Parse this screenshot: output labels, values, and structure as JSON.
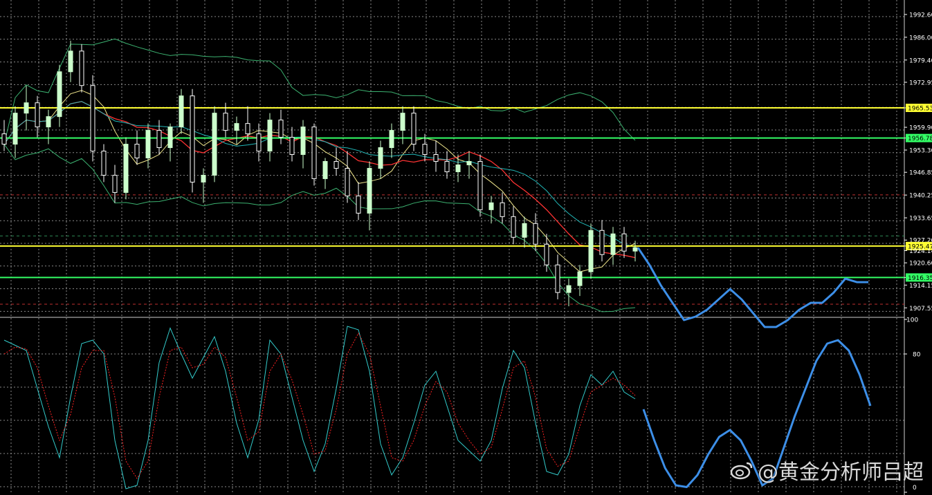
{
  "chart_data": [
    {
      "type": "candlestick",
      "panel": "price",
      "title": "",
      "grid": true,
      "yticks": [
        "1992.60",
        "1986.00",
        "1979.40",
        "1972.95",
        "1965.53",
        "1959.90",
        "1956.78",
        "1953.30",
        "1946.85",
        "1940.25",
        "1933.65",
        "1927.20",
        "1925.47",
        "1924.14",
        "1920.60",
        "1916.35",
        "1914.15",
        "1907.55"
      ],
      "ylim": [
        1905,
        1996
      ],
      "candles": [
        [
          1958,
          1962,
          1953,
          1955
        ],
        [
          1955,
          1966,
          1951,
          1964
        ],
        [
          1964,
          1972,
          1959,
          1967
        ],
        [
          1967,
          1969,
          1957,
          1960
        ],
        [
          1960,
          1965,
          1955,
          1963
        ],
        [
          1963,
          1978,
          1960,
          1976
        ],
        [
          1976,
          1985,
          1973,
          1982
        ],
        [
          1982,
          1984,
          1970,
          1972
        ],
        [
          1972,
          1975,
          1950,
          1953
        ],
        [
          1953,
          1955,
          1944,
          1946
        ],
        [
          1946,
          1949,
          1938,
          1941
        ],
        [
          1941,
          1957,
          1939,
          1955
        ],
        [
          1955,
          1959,
          1949,
          1951
        ],
        [
          1951,
          1961,
          1948,
          1959
        ],
        [
          1959,
          1962,
          1952,
          1954
        ],
        [
          1954,
          1961,
          1950,
          1960
        ],
        [
          1960,
          1971,
          1958,
          1969
        ],
        [
          1969,
          1971,
          1941,
          1944
        ],
        [
          1944,
          1948,
          1938,
          1946
        ],
        [
          1946,
          1966,
          1944,
          1964
        ],
        [
          1964,
          1967,
          1957,
          1959
        ],
        [
          1959,
          1963,
          1955,
          1961
        ],
        [
          1961,
          1966,
          1956,
          1958
        ],
        [
          1958,
          1961,
          1950,
          1953
        ],
        [
          1953,
          1964,
          1950,
          1962
        ],
        [
          1962,
          1965,
          1955,
          1957
        ],
        [
          1957,
          1960,
          1950,
          1952
        ],
        [
          1952,
          1962,
          1948,
          1960
        ],
        [
          1960,
          1961,
          1943,
          1945
        ],
        [
          1945,
          1951,
          1942,
          1950
        ],
        [
          1950,
          1954,
          1946,
          1948
        ],
        [
          1948,
          1953,
          1938,
          1940
        ],
        [
          1940,
          1944,
          1933,
          1935
        ],
        [
          1935,
          1950,
          1930,
          1948
        ],
        [
          1948,
          1956,
          1945,
          1954
        ],
        [
          1954,
          1961,
          1951,
          1959
        ],
        [
          1959,
          1966,
          1955,
          1964
        ],
        [
          1964,
          1966,
          1953,
          1955
        ],
        [
          1955,
          1958,
          1950,
          1952
        ],
        [
          1952,
          1956,
          1947,
          1950
        ],
        [
          1950,
          1953,
          1945,
          1947
        ],
        [
          1947,
          1952,
          1944,
          1949
        ],
        [
          1949,
          1953,
          1945,
          1950
        ],
        [
          1950,
          1952,
          1934,
          1936
        ],
        [
          1936,
          1940,
          1932,
          1938
        ],
        [
          1938,
          1941,
          1932,
          1934
        ],
        [
          1934,
          1937,
          1926,
          1928
        ],
        [
          1928,
          1934,
          1925,
          1932
        ],
        [
          1932,
          1935,
          1924,
          1926
        ],
        [
          1926,
          1929,
          1918,
          1920
        ],
        [
          1920,
          1923,
          1910,
          1912
        ],
        [
          1912,
          1916,
          1908,
          1914
        ],
        [
          1914,
          1920,
          1911,
          1918
        ],
        [
          1918,
          1932,
          1916,
          1930
        ],
        [
          1930,
          1933,
          1921,
          1923
        ],
        [
          1923,
          1931,
          1920,
          1929
        ],
        [
          1929,
          1931,
          1922,
          1924
        ],
        [
          1924,
          1927,
          1921,
          1925
        ]
      ],
      "horizontal_lines": [
        {
          "value": 1965.53,
          "color": "#ffff33",
          "label": "1965.53"
        },
        {
          "value": 1956.78,
          "color": "#33ff66",
          "label": "1956.78"
        },
        {
          "value": 1925.47,
          "color": "#ffff33",
          "label": "1925.47"
        },
        {
          "value": 1916.35,
          "color": "#33ff66",
          "label": "1916.35"
        }
      ],
      "forecast_path": [
        1925,
        1920,
        1914,
        1909,
        1904,
        1905,
        1907,
        1910,
        1913,
        1910,
        1906,
        1902,
        1902,
        1904,
        1907,
        1909,
        1909,
        1912,
        1916,
        1915,
        1915
      ],
      "colors": {
        "bull": "#ccffcc",
        "bear": "#ffffff",
        "forecast": "#3d8fe8",
        "ma_fast": "#f0e68c",
        "ma_mid": "#ff3333",
        "ma_slow": "#22b8b8",
        "band": "#3cb371",
        "grid": "#8a8a8a"
      }
    },
    {
      "type": "line",
      "panel": "oscillator",
      "yticks": [
        "100",
        "80",
        "0"
      ],
      "ylim": [
        0,
        100
      ],
      "series": [
        {
          "color": "#33cccc",
          "values": [
            88,
            85,
            82,
            60,
            38,
            20,
            55,
            86,
            88,
            80,
            30,
            2,
            4,
            30,
            75,
            95,
            80,
            66,
            78,
            90,
            70,
            40,
            20,
            42,
            88,
            80,
            55,
            30,
            12,
            28,
            60,
            96,
            94,
            70,
            28,
            10,
            20,
            40,
            62,
            70,
            50,
            30,
            24,
            18,
            30,
            60,
            82,
            72,
            40,
            12,
            10,
            22,
            50,
            68,
            62,
            70,
            58,
            54
          ]
        },
        {
          "color": "#ff2222",
          "dashed": true,
          "values": [
            80,
            84,
            83,
            72,
            50,
            30,
            45,
            72,
            82,
            82,
            55,
            18,
            8,
            18,
            55,
            82,
            84,
            72,
            74,
            84,
            78,
            55,
            30,
            35,
            70,
            80,
            65,
            45,
            22,
            24,
            48,
            80,
            92,
            80,
            50,
            20,
            18,
            30,
            50,
            64,
            58,
            40,
            30,
            22,
            26,
            48,
            72,
            76,
            55,
            25,
            15,
            18,
            38,
            58,
            62,
            66,
            62,
            56
          ]
        }
      ],
      "forecast_path": [
        48,
        30,
        14,
        4,
        3,
        10,
        22,
        32,
        36,
        30,
        18,
        4,
        8,
        26,
        44,
        60,
        76,
        86,
        88,
        82,
        68,
        50
      ]
    }
  ],
  "watermark": "@黄金分析师吕超"
}
